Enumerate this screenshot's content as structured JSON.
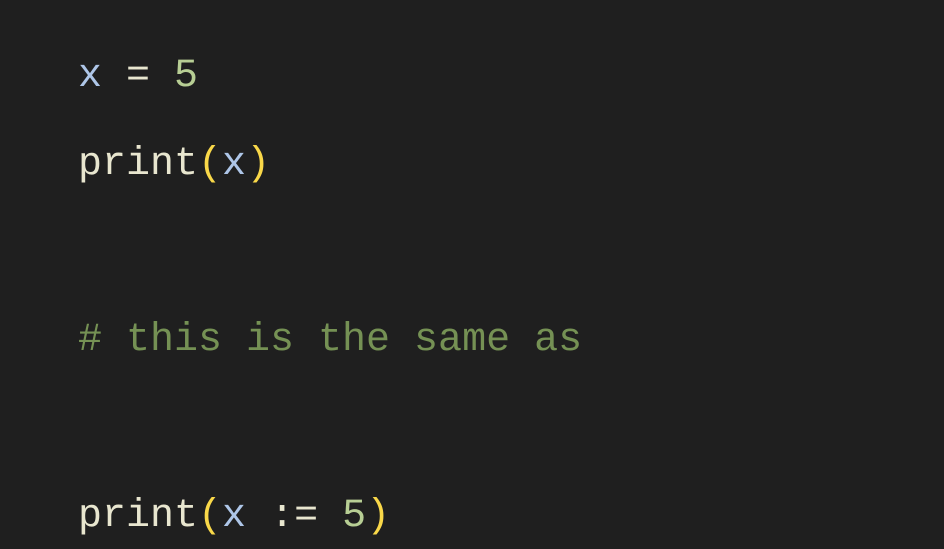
{
  "code": {
    "line1": {
      "var": "x",
      "op": " = ",
      "num": "5"
    },
    "line2": {
      "func": "print",
      "lparen": "(",
      "var": "x",
      "rparen": ")"
    },
    "line3": {
      "comment": "# this is the same as"
    },
    "line4": {
      "func": "print",
      "lparen": "(",
      "var": "x",
      "op": " := ",
      "num": "5",
      "rparen": ")"
    }
  }
}
